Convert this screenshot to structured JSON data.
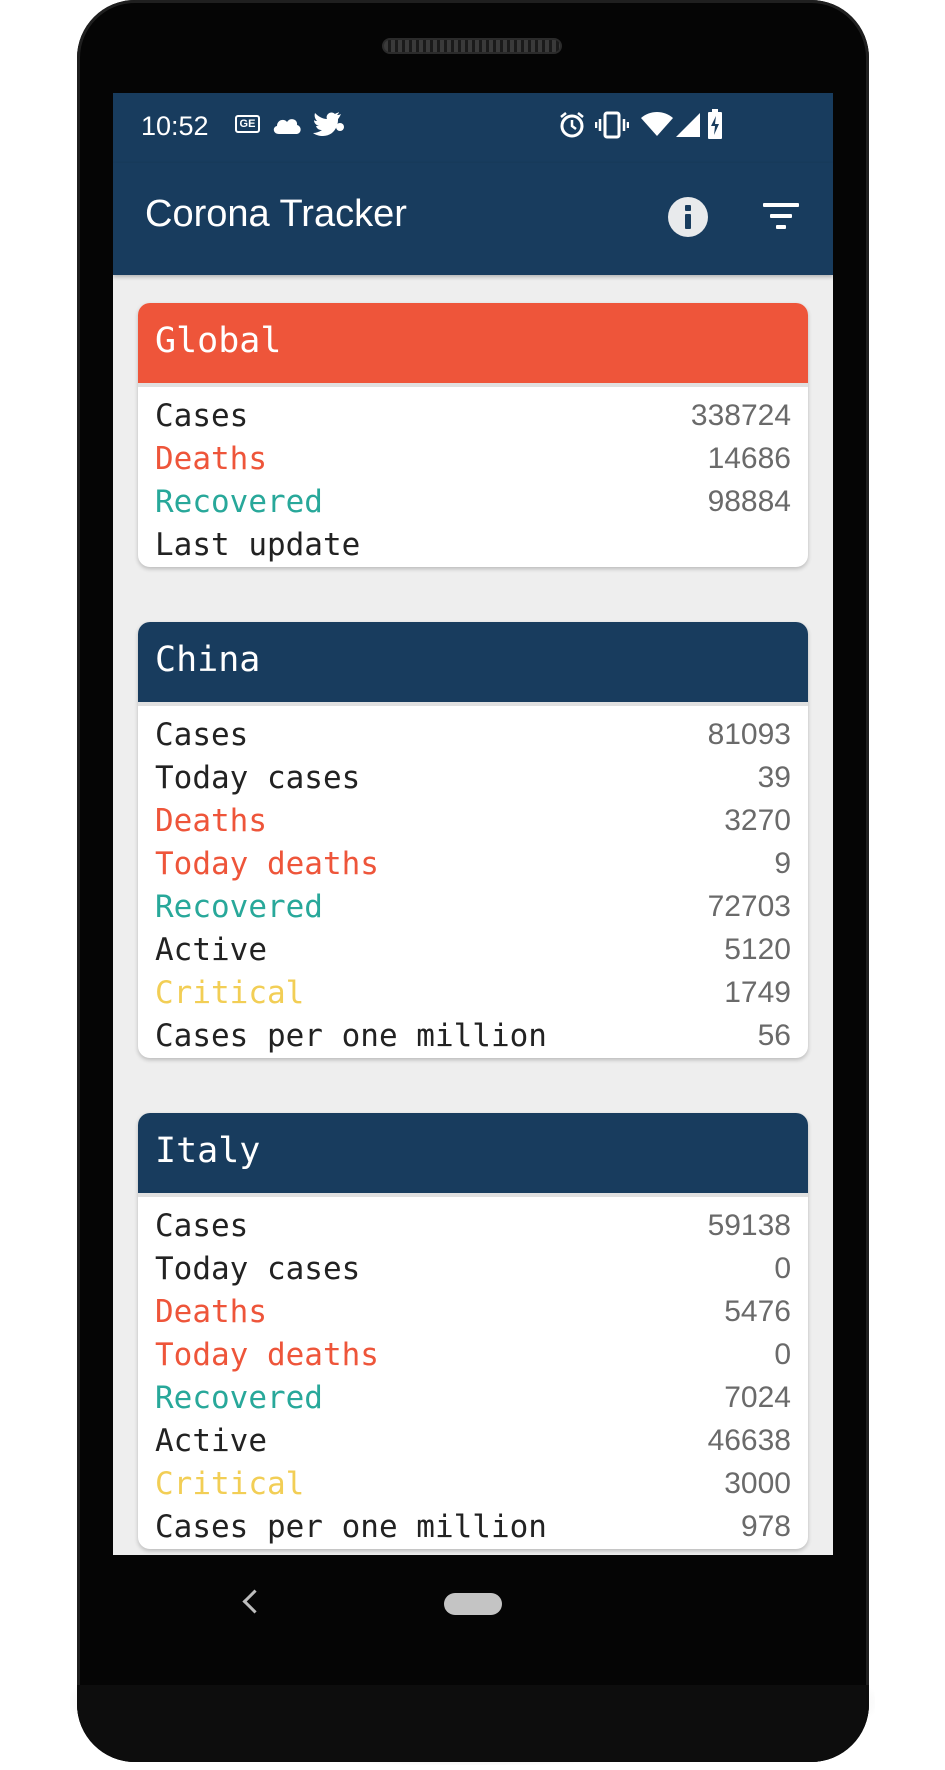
{
  "status_bar": {
    "time": "10:52",
    "left_icons": [
      "ge-news-icon",
      "cloud-icon",
      "twitter-icon",
      "notification-dot-icon"
    ],
    "right_icons": [
      "alarm-icon",
      "vibrate-icon",
      "wifi-icon",
      "signal-icon",
      "battery-charging-icon"
    ]
  },
  "app_bar": {
    "title": "Corona Tracker",
    "actions": [
      "info-icon",
      "filter-icon"
    ]
  },
  "colors": {
    "primary": "#183c5e",
    "global_header": "#ee553a",
    "deaths": "#ee553a",
    "recovered": "#28a89a",
    "critical": "#f2ce55",
    "text": "#222222",
    "value": "#6a6a6a"
  },
  "cards": [
    {
      "title": "Global",
      "rows": [
        {
          "label": "Cases",
          "value": "338724"
        },
        {
          "label": "Deaths",
          "value": "14686"
        },
        {
          "label": "Recovered",
          "value": "98884"
        },
        {
          "label": "Last update",
          "value": ""
        }
      ]
    },
    {
      "title": "China",
      "rows": [
        {
          "label": "Cases",
          "value": "81093"
        },
        {
          "label": "Today cases",
          "value": "39"
        },
        {
          "label": "Deaths",
          "value": "3270"
        },
        {
          "label": "Today deaths",
          "value": "9"
        },
        {
          "label": "Recovered",
          "value": "72703"
        },
        {
          "label": "Active",
          "value": "5120"
        },
        {
          "label": "Critical",
          "value": "1749"
        },
        {
          "label": "Cases per one million",
          "value": "56"
        }
      ]
    },
    {
      "title": "Italy",
      "rows": [
        {
          "label": "Cases",
          "value": "59138"
        },
        {
          "label": "Today cases",
          "value": "0"
        },
        {
          "label": "Deaths",
          "value": "5476"
        },
        {
          "label": "Today deaths",
          "value": "0"
        },
        {
          "label": "Recovered",
          "value": "7024"
        },
        {
          "label": "Active",
          "value": "46638"
        },
        {
          "label": "Critical",
          "value": "3000"
        },
        {
          "label": "Cases per one million",
          "value": "978"
        }
      ]
    }
  ],
  "nav_bar": {
    "buttons": [
      "back-icon",
      "home-icon"
    ]
  }
}
